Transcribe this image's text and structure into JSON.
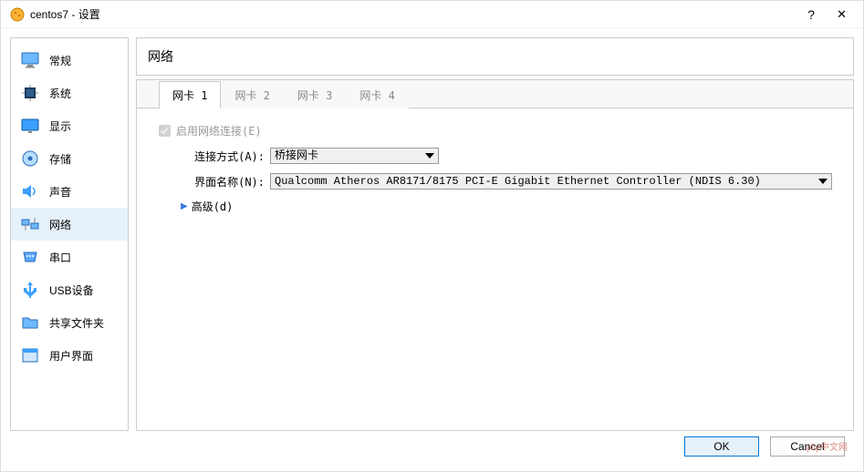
{
  "title": "centos7 - 设置",
  "sidebar": {
    "items": [
      {
        "label": "常规"
      },
      {
        "label": "系统"
      },
      {
        "label": "显示"
      },
      {
        "label": "存储"
      },
      {
        "label": "声音"
      },
      {
        "label": "网络"
      },
      {
        "label": "串口"
      },
      {
        "label": "USB设备"
      },
      {
        "label": "共享文件夹"
      },
      {
        "label": "用户界面"
      }
    ]
  },
  "header": "网络",
  "tabs": [
    "网卡 1",
    "网卡 2",
    "网卡 3",
    "网卡 4"
  ],
  "form": {
    "enable_label": "启用网络连接(E)",
    "attached_label": "连接方式(A):",
    "attached_value": "桥接网卡",
    "name_label": "界面名称(N):",
    "name_value": "Qualcomm Atheros AR8171/8175 PCI-E Gigabit Ethernet Controller (NDIS 6.30)",
    "advanced_label": "高级(d)"
  },
  "buttons": {
    "ok": "OK",
    "cancel": "Cancel"
  },
  "watermark": "php中文网"
}
